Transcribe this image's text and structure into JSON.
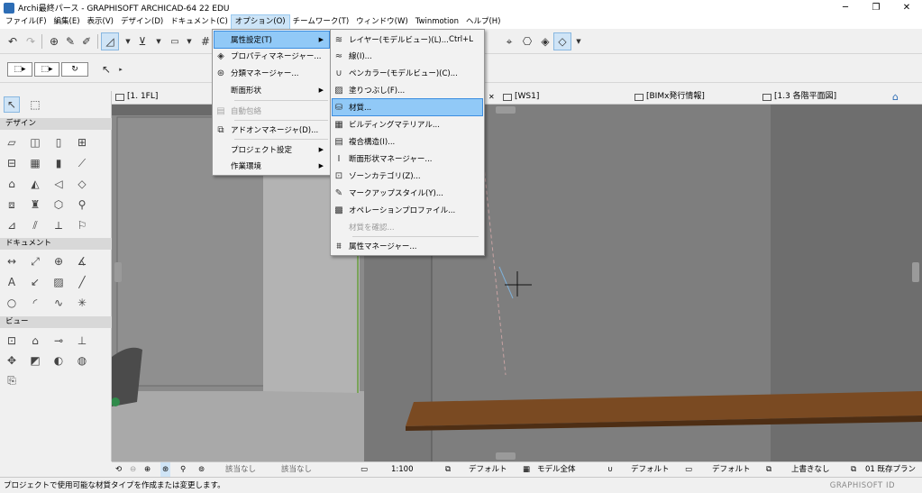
{
  "window": {
    "title": "Archi最終パース - GRAPHISOFT ARCHICAD-64 22 EDU",
    "minimize": "─",
    "restore": "❐",
    "close": "✕"
  },
  "menubar": [
    {
      "label": "ファイル(F)"
    },
    {
      "label": "編集(E)"
    },
    {
      "label": "表示(V)"
    },
    {
      "label": "デザイン(D)"
    },
    {
      "label": "ドキュメント(C)"
    },
    {
      "label": "オプション(O)",
      "active": true
    },
    {
      "label": "チームワーク(T)"
    },
    {
      "label": "ウィンドウ(W)"
    },
    {
      "label": "Twinmotion"
    },
    {
      "label": "ヘルプ(H)"
    }
  ],
  "options_menu": {
    "items": [
      {
        "label": "属性設定(T)",
        "submenu": true,
        "highlighted": true
      },
      {
        "label": "プロパティマネージャー...",
        "icon": "tag-icon"
      },
      {
        "label": "分類マネージャー...",
        "icon": "classification-icon"
      },
      {
        "label": "断面形状",
        "submenu": true
      },
      {
        "label": "自動包絡",
        "disabled": true,
        "icon": "merge-icon"
      },
      {
        "label": "アドオンマネージャ(D)...",
        "icon": "addon-icon"
      },
      {
        "label": "プロジェクト設定",
        "submenu": true
      },
      {
        "label": "作業環境",
        "submenu": true
      }
    ]
  },
  "attributes_submenu": {
    "items": [
      {
        "label": "レイヤー(モデルビュー)(L)...",
        "shortcut": "Ctrl+L",
        "icon": "layers-icon"
      },
      {
        "label": "線(I)...",
        "icon": "line-icon"
      },
      {
        "label": "ペンカラー(モデルビュー)(C)...",
        "icon": "pen-icon"
      },
      {
        "label": "塗りつぶし(F)...",
        "icon": "fill-icon"
      },
      {
        "label": "材質...",
        "icon": "material-icon",
        "highlighted": true
      },
      {
        "label": "ビルディングマテリアル...",
        "icon": "building-material-icon"
      },
      {
        "label": "複合構造(I)...",
        "icon": "composite-icon"
      },
      {
        "label": "断面形状マネージャー...",
        "icon": "profile-icon"
      },
      {
        "label": "ゾーンカテゴリ(Z)...",
        "icon": "zone-icon"
      },
      {
        "label": "マークアップスタイル(Y)...",
        "icon": "markup-icon"
      },
      {
        "label": "オペレーションプロファイル...",
        "icon": "operation-icon"
      },
      {
        "label": "材質を確認...",
        "disabled": true
      },
      {
        "label": "属性マネージャー...",
        "icon": "attribute-manager-icon"
      }
    ]
  },
  "tabs": [
    {
      "label": "[1. 1FL]"
    },
    {
      "label": "[WS1]"
    },
    {
      "label": "[BIMx発行情報]"
    },
    {
      "label": "[1.3 各階平面図]"
    }
  ],
  "toolbox": {
    "sections": [
      "デザイン",
      "ドキュメント",
      "ビュー"
    ]
  },
  "bottombar": {
    "none1": "該当なし",
    "none2": "該当なし",
    "scale": "1:100",
    "default1": "デフォルト",
    "model": "モデル全体",
    "default2": "デフォルト",
    "default3": "デフォルト",
    "overwrite": "上書きなし",
    "plan": "01 既存プラン"
  },
  "statusbar": {
    "message": "プロジェクトで使用可能な材質タイプを作成または変更します。",
    "brand": "GRAPHISOFT ID"
  },
  "colors": {
    "highlight": "#91c9f7",
    "menu_active": "#cce4f7",
    "table_wood": "#7a4a22"
  }
}
